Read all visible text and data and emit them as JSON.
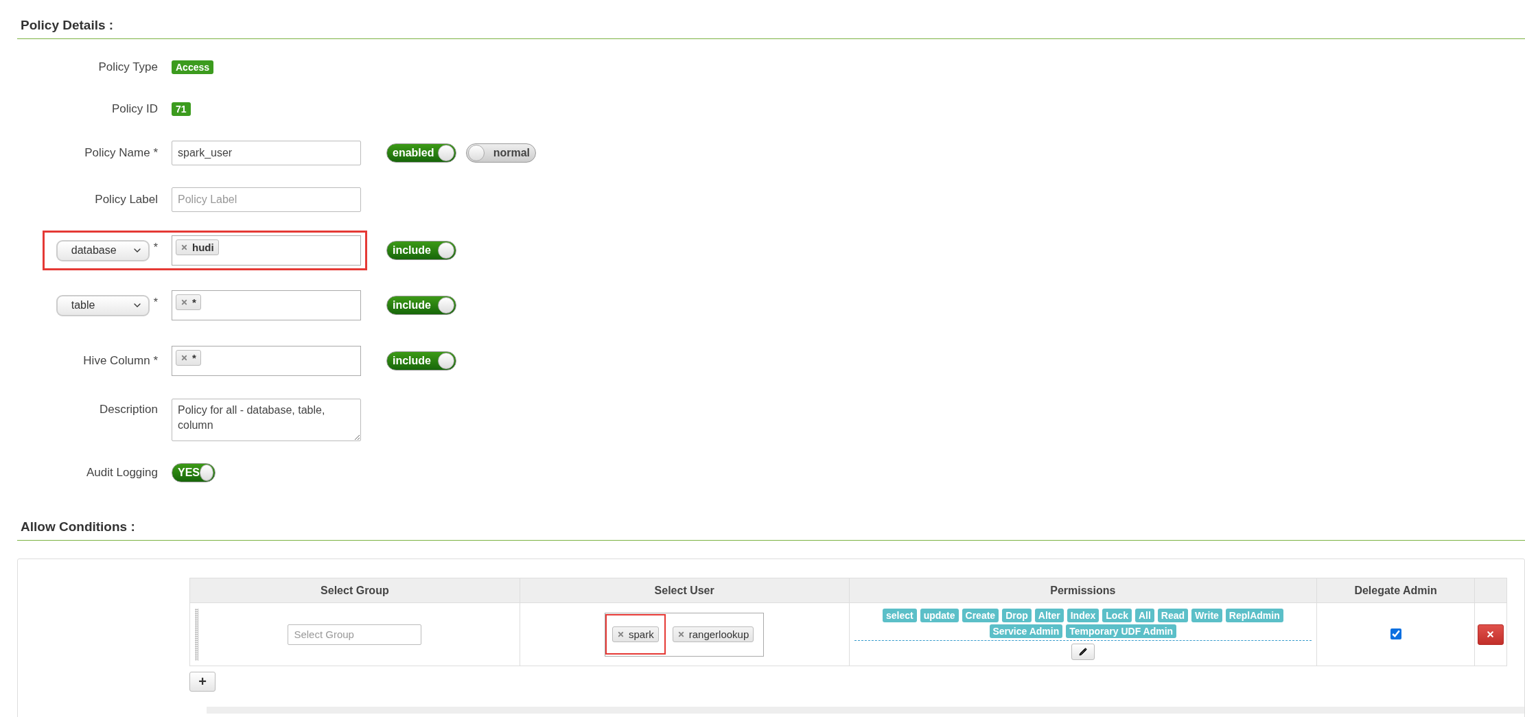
{
  "policy_details": {
    "title": "Policy Details :",
    "fields": [
      {
        "kind": "badge",
        "label": "Policy Type",
        "value": "Access"
      },
      {
        "kind": "badge",
        "label": "Policy ID",
        "value": "71"
      },
      {
        "kind": "text",
        "label": "Policy Name *",
        "value": "spark_user",
        "toggles": [
          {
            "label": "enabled",
            "on": true
          },
          {
            "label": "normal",
            "on": false
          }
        ]
      },
      {
        "kind": "text",
        "label": "Policy Label",
        "placeholder": "Policy Label"
      },
      {
        "kind": "resource",
        "select": "database",
        "required": "*",
        "tags": [
          "hudi"
        ],
        "toggle": {
          "label": "include",
          "on": true
        },
        "highlighted": true
      },
      {
        "kind": "resource",
        "select": "table",
        "required": "*",
        "tags": [
          "*"
        ],
        "toggle": {
          "label": "include",
          "on": true
        },
        "highlighted": false
      },
      {
        "kind": "tags",
        "label": "Hive Column *",
        "tags": [
          "*"
        ],
        "toggle": {
          "label": "include",
          "on": true
        }
      },
      {
        "kind": "textarea",
        "label": "Description",
        "value": "Policy for all - database, table, column"
      },
      {
        "kind": "switch",
        "label": "Audit Logging",
        "toggle": {
          "label": "YES",
          "on": true
        }
      }
    ]
  },
  "allow_conditions": {
    "title": "Allow Conditions :",
    "columns": [
      "Select Group",
      "Select User",
      "Permissions",
      "Delegate Admin"
    ],
    "rows": [
      {
        "group_placeholder": "Select Group",
        "users": [
          {
            "label": "spark",
            "highlighted": true
          },
          {
            "label": "rangerlookup",
            "highlighted": false
          }
        ],
        "permissions": [
          "select",
          "update",
          "Create",
          "Drop",
          "Alter",
          "Index",
          "Lock",
          "All",
          "Read",
          "Write",
          "ReplAdmin",
          "Service Admin",
          "Temporary UDF Admin"
        ],
        "delegate_admin": true
      }
    ],
    "add_button": "+"
  }
}
